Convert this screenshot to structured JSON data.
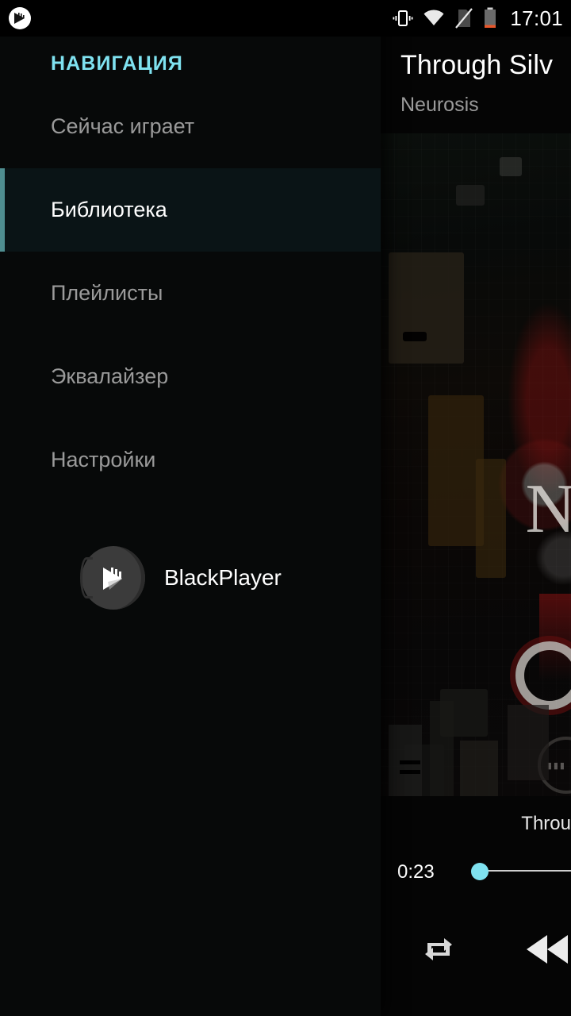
{
  "status_bar": {
    "app_icon": "blackplayer-notification-icon",
    "icons": [
      "vibrate-icon",
      "wifi-icon",
      "no-sim-card-icon",
      "battery-low-icon"
    ],
    "clock": "17:01",
    "battery_accent_color": "#e8562a"
  },
  "drawer": {
    "header": "НАВИГАЦИЯ",
    "header_color": "#7fe2f0",
    "accent_color": "#4f8e90",
    "active_index": 1,
    "items": [
      {
        "label": "Сейчас играет",
        "name": "sidebar-item-now-playing"
      },
      {
        "label": "Библиотека",
        "name": "sidebar-item-library"
      },
      {
        "label": "Плейлисты",
        "name": "sidebar-item-playlists"
      },
      {
        "label": "Эквалайзер",
        "name": "sidebar-item-equalizer"
      },
      {
        "label": "Настройки",
        "name": "sidebar-item-settings"
      }
    ],
    "brand": {
      "name": "BlackPlayer",
      "logo_icon": "blackplayer-logo-icon"
    }
  },
  "player": {
    "title": "Through Silv",
    "artist": "Neurosis",
    "album_art": "album-artwork",
    "strip_title": "Throu",
    "seek": {
      "elapsed": "0:23",
      "thumb_color": "#7fe2f0",
      "track_color": "#cfcfcf",
      "progress_percent": 4
    },
    "controls": [
      {
        "name": "repeat-button",
        "icon": "repeat-icon"
      },
      {
        "name": "previous-button",
        "icon": "rewind-icon"
      }
    ]
  },
  "colors": {
    "background": "#000000",
    "drawer_background": "#070909",
    "active_row_background": "#0a1416",
    "accent_cyan": "#7fe2f0",
    "muted_text": "#9a9a9a"
  }
}
